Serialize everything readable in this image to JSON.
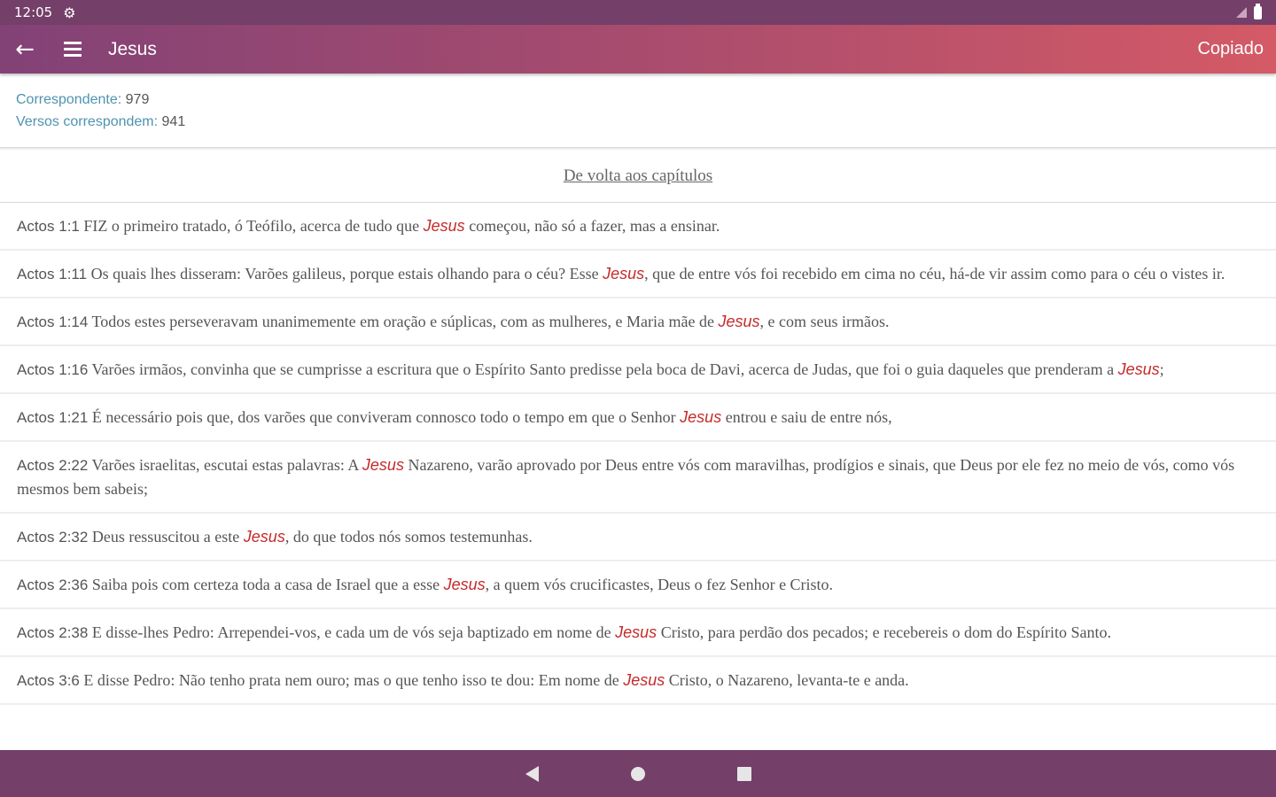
{
  "status_bar": {
    "time": "12:05"
  },
  "app_bar": {
    "title": "Jesus",
    "action": "Copiado"
  },
  "stats": {
    "matches_label": "Correspondente:",
    "matches_value": "979",
    "verses_label": "Versos correspondem:",
    "verses_value": "941"
  },
  "back_link": "De volta aos capítulos",
  "verses": [
    {
      "ref": "Actos 1:1",
      "before": "FIZ o primeiro tratado, ó Teófilo, acerca de tudo que ",
      "term": "Jesus",
      "after": " começou, não só a fazer, mas a ensinar."
    },
    {
      "ref": "Actos 1:11",
      "before": "Os quais lhes disseram: Varões galileus, porque estais olhando para o céu? Esse ",
      "term": "Jesus",
      "after": ", que de entre vós foi recebido em cima no céu, há-de vir assim como para o céu o vistes ir."
    },
    {
      "ref": "Actos 1:14",
      "before": "Todos estes perseveravam unanimemente em oração e súplicas, com as mulheres, e Maria mãe de ",
      "term": "Jesus",
      "after": ", e com seus irmãos."
    },
    {
      "ref": "Actos 1:16",
      "before": "Varões irmãos, convinha que se cumprisse a escritura que o Espírito Santo predisse pela boca de Davi, acerca de Judas, que foi o guia daqueles que prenderam a ",
      "term": "Jesus",
      "after": ";"
    },
    {
      "ref": "Actos 1:21",
      "before": "É necessário pois que, dos varões que conviveram connosco todo o tempo em que o Senhor ",
      "term": "Jesus",
      "after": " entrou e saiu de entre nós,"
    },
    {
      "ref": "Actos 2:22",
      "before": "Varões israelitas, escutai estas palavras: A ",
      "term": "Jesus",
      "after": " Nazareno, varão aprovado por Deus entre vós com maravilhas, prodígios e sinais, que Deus por ele fez no meio de vós, como vós mesmos bem sabeis;"
    },
    {
      "ref": "Actos 2:32",
      "before": "Deus ressuscitou a este ",
      "term": "Jesus",
      "after": ", do que todos nós somos testemunhas."
    },
    {
      "ref": "Actos 2:36",
      "before": "Saiba pois com certeza toda a casa de Israel que a esse ",
      "term": "Jesus",
      "after": ", a quem vós crucificastes, Deus o fez Senhor e Cristo."
    },
    {
      "ref": "Actos 2:38",
      "before": "E disse-lhes Pedro: Arrependei-vos, e cada um de vós seja baptizado em nome de ",
      "term": "Jesus",
      "after": " Cristo, para perdão dos pecados; e recebereis o dom do Espírito Santo."
    },
    {
      "ref": "Actos 3:6",
      "before": "E disse Pedro: Não tenho prata nem ouro; mas o que tenho isso te dou: Em nome de ",
      "term": "Jesus",
      "after": " Cristo, o Nazareno, levanta-te e anda."
    }
  ],
  "colors": {
    "status_bar": "#743f68",
    "app_bar_start": "#824276",
    "app_bar_end": "#d45a66",
    "highlight": "#c62a2a",
    "stats_label": "#4f93b0"
  },
  "icons": {
    "settings": "gear-icon",
    "back": "arrow-left-icon",
    "menu": "hamburger-menu-icon",
    "signal": "signal-icon",
    "battery": "battery-icon",
    "nav_back": "triangle-back-icon",
    "nav_home": "circle-home-icon",
    "nav_recent": "square-recents-icon"
  }
}
